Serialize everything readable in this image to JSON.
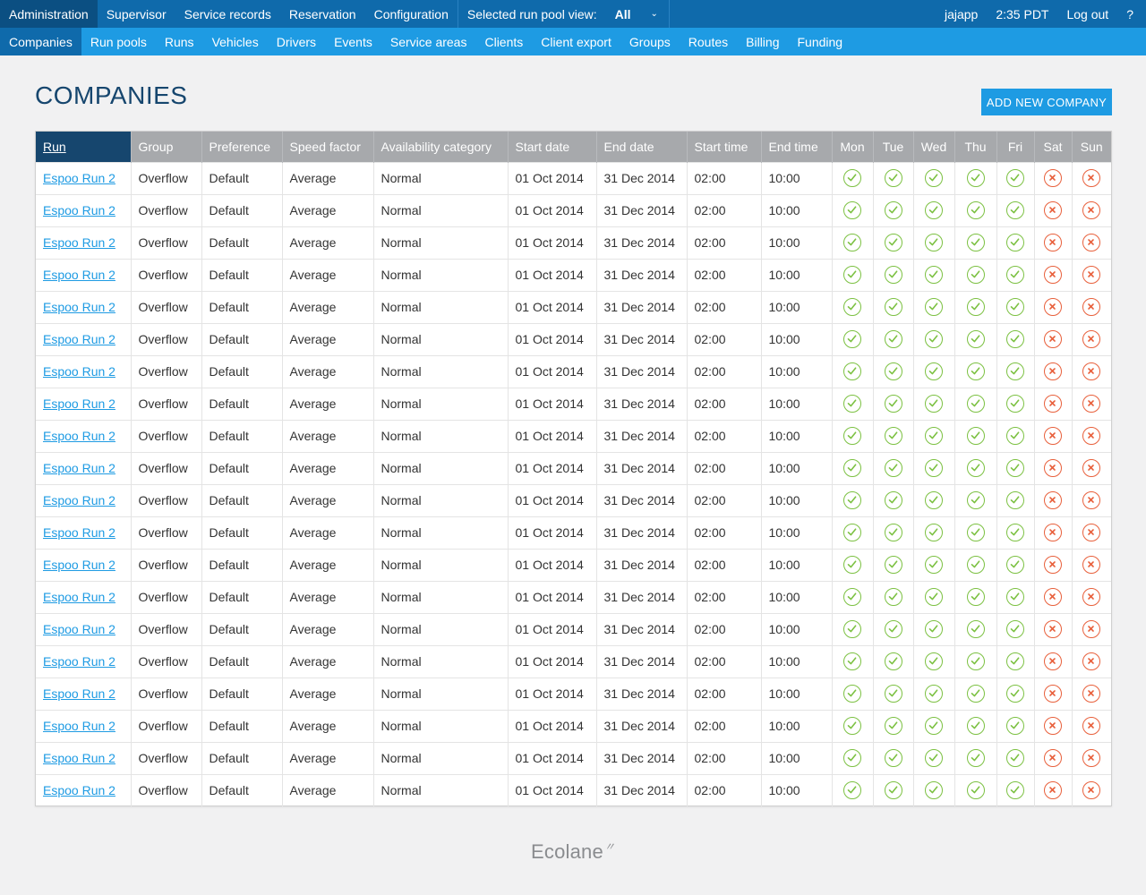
{
  "topnav": {
    "items": [
      "Administration",
      "Supervisor",
      "Service records",
      "Reservation",
      "Configuration"
    ],
    "pool_view_label": "Selected run pool view:",
    "pool_view_value": "All",
    "user": "jajapp",
    "time": "2:35 PDT",
    "logout": "Log out",
    "help": "?"
  },
  "subnav": {
    "items": [
      "Companies",
      "Run pools",
      "Runs",
      "Vehicles",
      "Drivers",
      "Events",
      "Service areas",
      "Clients",
      "Client export",
      "Groups",
      "Routes",
      "Billing",
      "Funding"
    ]
  },
  "page": {
    "title": "COMPANIES",
    "add_button": "ADD NEW COMPANY"
  },
  "table": {
    "columns": [
      "Run",
      "Group",
      "Preference",
      "Speed factor",
      "Availability category",
      "Start date",
      "End date",
      "Start time",
      "End time",
      "Mon",
      "Tue",
      "Wed",
      "Thu",
      "Fri",
      "Sat",
      "Sun"
    ],
    "rows": [
      {
        "run": "Espoo Run 2",
        "group": "Overflow",
        "preference": "Default",
        "speed": "Average",
        "availability": "Normal",
        "start_date": "01 Oct 2014",
        "end_date": "31 Dec 2014",
        "start_time": "02:00",
        "end_time": "10:00",
        "days": [
          true,
          true,
          true,
          true,
          true,
          false,
          false
        ]
      },
      {
        "run": "Espoo Run 2",
        "group": "Overflow",
        "preference": "Default",
        "speed": "Average",
        "availability": "Normal",
        "start_date": "01 Oct 2014",
        "end_date": "31 Dec 2014",
        "start_time": "02:00",
        "end_time": "10:00",
        "days": [
          true,
          true,
          true,
          true,
          true,
          false,
          false
        ]
      },
      {
        "run": "Espoo Run 2",
        "group": "Overflow",
        "preference": "Default",
        "speed": "Average",
        "availability": "Normal",
        "start_date": "01 Oct 2014",
        "end_date": "31 Dec 2014",
        "start_time": "02:00",
        "end_time": "10:00",
        "days": [
          true,
          true,
          true,
          true,
          true,
          false,
          false
        ]
      },
      {
        "run": "Espoo Run 2",
        "group": "Overflow",
        "preference": "Default",
        "speed": "Average",
        "availability": "Normal",
        "start_date": "01 Oct 2014",
        "end_date": "31 Dec 2014",
        "start_time": "02:00",
        "end_time": "10:00",
        "days": [
          true,
          true,
          true,
          true,
          true,
          false,
          false
        ]
      },
      {
        "run": "Espoo Run 2",
        "group": "Overflow",
        "preference": "Default",
        "speed": "Average",
        "availability": "Normal",
        "start_date": "01 Oct 2014",
        "end_date": "31 Dec 2014",
        "start_time": "02:00",
        "end_time": "10:00",
        "days": [
          true,
          true,
          true,
          true,
          true,
          false,
          false
        ]
      },
      {
        "run": "Espoo Run 2",
        "group": "Overflow",
        "preference": "Default",
        "speed": "Average",
        "availability": "Normal",
        "start_date": "01 Oct 2014",
        "end_date": "31 Dec 2014",
        "start_time": "02:00",
        "end_time": "10:00",
        "days": [
          true,
          true,
          true,
          true,
          true,
          false,
          false
        ]
      },
      {
        "run": "Espoo Run 2",
        "group": "Overflow",
        "preference": "Default",
        "speed": "Average",
        "availability": "Normal",
        "start_date": "01 Oct 2014",
        "end_date": "31 Dec 2014",
        "start_time": "02:00",
        "end_time": "10:00",
        "days": [
          true,
          true,
          true,
          true,
          true,
          false,
          false
        ]
      },
      {
        "run": "Espoo Run 2",
        "group": "Overflow",
        "preference": "Default",
        "speed": "Average",
        "availability": "Normal",
        "start_date": "01 Oct 2014",
        "end_date": "31 Dec 2014",
        "start_time": "02:00",
        "end_time": "10:00",
        "days": [
          true,
          true,
          true,
          true,
          true,
          false,
          false
        ]
      },
      {
        "run": "Espoo Run 2",
        "group": "Overflow",
        "preference": "Default",
        "speed": "Average",
        "availability": "Normal",
        "start_date": "01 Oct 2014",
        "end_date": "31 Dec 2014",
        "start_time": "02:00",
        "end_time": "10:00",
        "days": [
          true,
          true,
          true,
          true,
          true,
          false,
          false
        ]
      },
      {
        "run": "Espoo Run 2",
        "group": "Overflow",
        "preference": "Default",
        "speed": "Average",
        "availability": "Normal",
        "start_date": "01 Oct 2014",
        "end_date": "31 Dec 2014",
        "start_time": "02:00",
        "end_time": "10:00",
        "days": [
          true,
          true,
          true,
          true,
          true,
          false,
          false
        ]
      },
      {
        "run": "Espoo Run 2",
        "group": "Overflow",
        "preference": "Default",
        "speed": "Average",
        "availability": "Normal",
        "start_date": "01 Oct 2014",
        "end_date": "31 Dec 2014",
        "start_time": "02:00",
        "end_time": "10:00",
        "days": [
          true,
          true,
          true,
          true,
          true,
          false,
          false
        ]
      },
      {
        "run": "Espoo Run 2",
        "group": "Overflow",
        "preference": "Default",
        "speed": "Average",
        "availability": "Normal",
        "start_date": "01 Oct 2014",
        "end_date": "31 Dec 2014",
        "start_time": "02:00",
        "end_time": "10:00",
        "days": [
          true,
          true,
          true,
          true,
          true,
          false,
          false
        ]
      },
      {
        "run": "Espoo Run 2",
        "group": "Overflow",
        "preference": "Default",
        "speed": "Average",
        "availability": "Normal",
        "start_date": "01 Oct 2014",
        "end_date": "31 Dec 2014",
        "start_time": "02:00",
        "end_time": "10:00",
        "days": [
          true,
          true,
          true,
          true,
          true,
          false,
          false
        ]
      },
      {
        "run": "Espoo Run 2",
        "group": "Overflow",
        "preference": "Default",
        "speed": "Average",
        "availability": "Normal",
        "start_date": "01 Oct 2014",
        "end_date": "31 Dec 2014",
        "start_time": "02:00",
        "end_time": "10:00",
        "days": [
          true,
          true,
          true,
          true,
          true,
          false,
          false
        ]
      },
      {
        "run": "Espoo Run 2",
        "group": "Overflow",
        "preference": "Default",
        "speed": "Average",
        "availability": "Normal",
        "start_date": "01 Oct 2014",
        "end_date": "31 Dec 2014",
        "start_time": "02:00",
        "end_time": "10:00",
        "days": [
          true,
          true,
          true,
          true,
          true,
          false,
          false
        ]
      },
      {
        "run": "Espoo Run 2",
        "group": "Overflow",
        "preference": "Default",
        "speed": "Average",
        "availability": "Normal",
        "start_date": "01 Oct 2014",
        "end_date": "31 Dec 2014",
        "start_time": "02:00",
        "end_time": "10:00",
        "days": [
          true,
          true,
          true,
          true,
          true,
          false,
          false
        ]
      },
      {
        "run": "Espoo Run 2",
        "group": "Overflow",
        "preference": "Default",
        "speed": "Average",
        "availability": "Normal",
        "start_date": "01 Oct 2014",
        "end_date": "31 Dec 2014",
        "start_time": "02:00",
        "end_time": "10:00",
        "days": [
          true,
          true,
          true,
          true,
          true,
          false,
          false
        ]
      },
      {
        "run": "Espoo Run 2",
        "group": "Overflow",
        "preference": "Default",
        "speed": "Average",
        "availability": "Normal",
        "start_date": "01 Oct 2014",
        "end_date": "31 Dec 2014",
        "start_time": "02:00",
        "end_time": "10:00",
        "days": [
          true,
          true,
          true,
          true,
          true,
          false,
          false
        ]
      },
      {
        "run": "Espoo Run 2",
        "group": "Overflow",
        "preference": "Default",
        "speed": "Average",
        "availability": "Normal",
        "start_date": "01 Oct 2014",
        "end_date": "31 Dec 2014",
        "start_time": "02:00",
        "end_time": "10:00",
        "days": [
          true,
          true,
          true,
          true,
          true,
          false,
          false
        ]
      },
      {
        "run": "Espoo Run 2",
        "group": "Overflow",
        "preference": "Default",
        "speed": "Average",
        "availability": "Normal",
        "start_date": "01 Oct 2014",
        "end_date": "31 Dec 2014",
        "start_time": "02:00",
        "end_time": "10:00",
        "days": [
          true,
          true,
          true,
          true,
          true,
          false,
          false
        ]
      }
    ]
  },
  "footer": {
    "brand": "Ecolane"
  },
  "icons": {
    "available": "check-circle-icon",
    "unavailable": "x-circle-icon",
    "dropdown": "chevron-down-icon",
    "logo_mark": "swoosh-icon"
  },
  "colors": {
    "topbar": "#0f6aab",
    "topbar_active": "#0b4f82",
    "subnav": "#1e9be3",
    "header_gray": "#a7a9ac",
    "header_sorted": "#16466e",
    "check_green": "#7cc142",
    "x_red": "#e8603c",
    "title_navy": "#16466e"
  }
}
